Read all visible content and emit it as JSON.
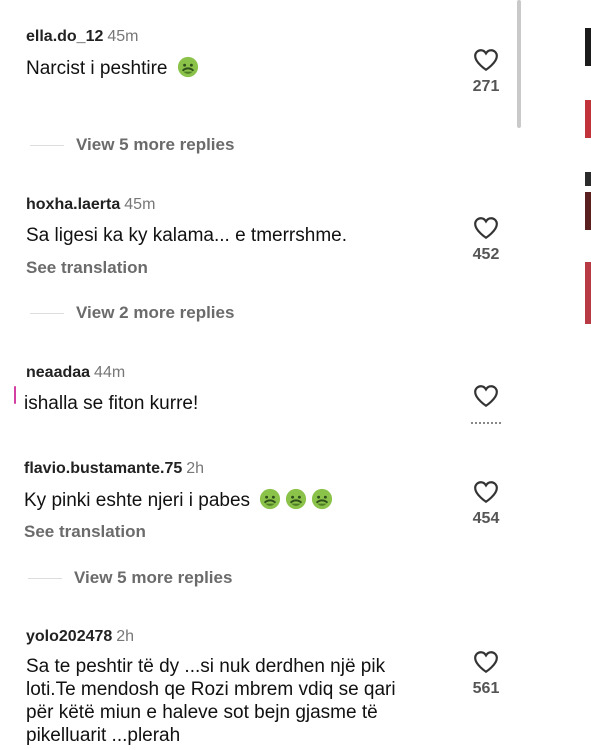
{
  "colors": {
    "accent_pink": "#d43fa2",
    "scrollbar": "#c9c9c9"
  },
  "comments": [
    {
      "user": "ella.do_12",
      "time": "45m",
      "text": "Narcist i peshtire",
      "emoji_count": 1,
      "likes": "271",
      "replies": "View 5 more replies"
    },
    {
      "user": "hoxha.laerta",
      "time": "45m",
      "text": "Sa ligesi ka ky kalama... e tmerrshme.",
      "see_translation": "See translation",
      "likes": "452",
      "replies": "View 2 more replies"
    },
    {
      "user": "neaadaa",
      "time": "44m",
      "text": "ishalla se fiton kurre!"
    },
    {
      "user": "flavio.bustamante.75",
      "time": "2h",
      "text": "Ky pinki eshte njeri i pabes",
      "emoji_count": 3,
      "see_translation": "See translation",
      "likes": "454",
      "replies": "View 5 more replies"
    },
    {
      "user": "yolo202478",
      "time": "2h",
      "text_lines": [
        "Sa te peshtir të dy ...si nuk derdhen një pik",
        "loti.Te mendosh qe Rozi mbrem vdiq se qari",
        "për këtë miun e haleve sot bejn gjasme të",
        "pikelluarit ...plerah"
      ],
      "likes": "561"
    }
  ],
  "icons": {
    "like": "heart-outline-icon",
    "emoji": "nauseated-face-icon"
  }
}
